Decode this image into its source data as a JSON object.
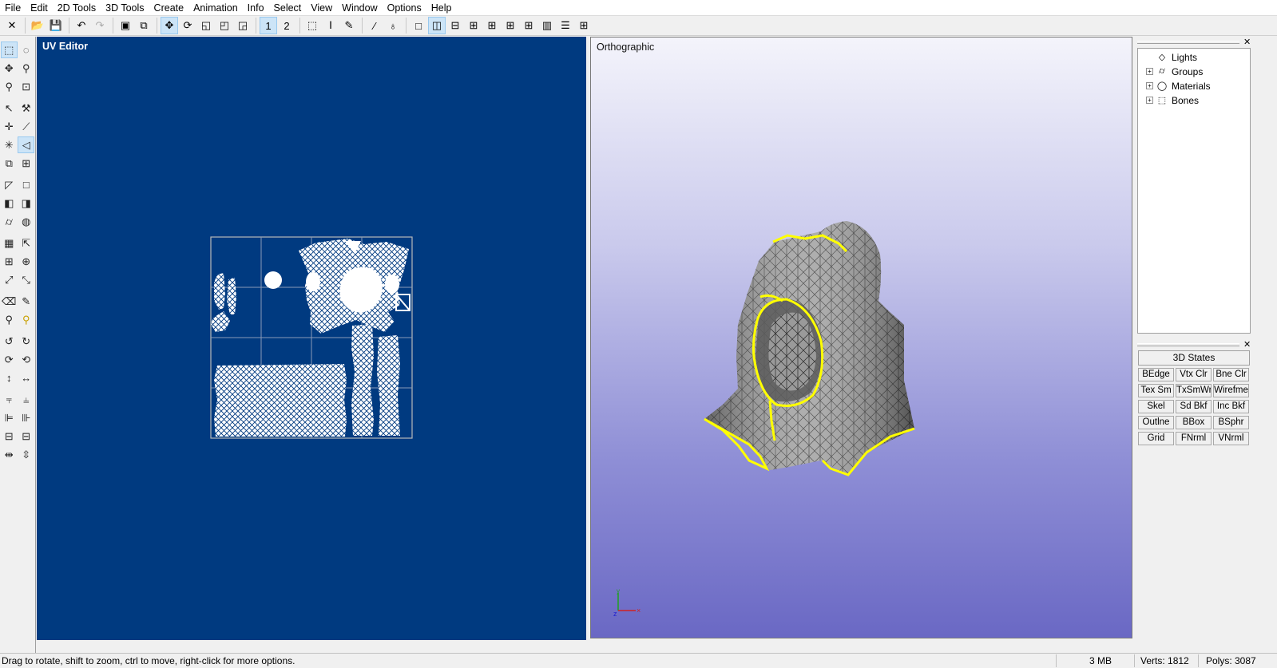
{
  "menu": [
    "File",
    "Edit",
    "2D Tools",
    "3D Tools",
    "Create",
    "Animation",
    "Info",
    "Select",
    "View",
    "Window",
    "Options",
    "Help"
  ],
  "toolbar": {
    "icons": [
      "close-icon",
      "open-icon",
      "save-icon",
      "undo-icon",
      "redo-icon",
      "snapshot-icon",
      "copy-icon",
      "move-icon",
      "rotate-icon",
      "scale-icon",
      "frame-icon",
      "frame-all-icon"
    ],
    "page1": "1",
    "page2": "2"
  },
  "uv_editor": {
    "title": "UV Editor"
  },
  "ortho": {
    "title": "Orthographic"
  },
  "scene_tree": {
    "items": [
      "Lights",
      "Groups",
      "Materials",
      "Bones"
    ]
  },
  "states": {
    "title": "3D States",
    "buttons": [
      "BEdge",
      "Vtx Clr",
      "Bne Clr",
      "Tex Sm",
      "TxSmWr",
      "Wirefme",
      "Skel",
      "Sd Bkf",
      "Inc Bkf",
      "Outlne",
      "BBox",
      "BSphr",
      "Grid",
      "FNrml",
      "VNrml"
    ]
  },
  "status": {
    "hint": "Drag to rotate, shift to zoom, ctrl to move, right-click for more options.",
    "memory": "3 MB",
    "verts": "Verts: 1812",
    "polys": "Polys: 3087"
  },
  "colors": {
    "uv_bg": "#003a80",
    "wire_highlight": "#ffff00",
    "ortho_top": "#f4f4fb",
    "ortho_bottom": "#6a68c4"
  }
}
